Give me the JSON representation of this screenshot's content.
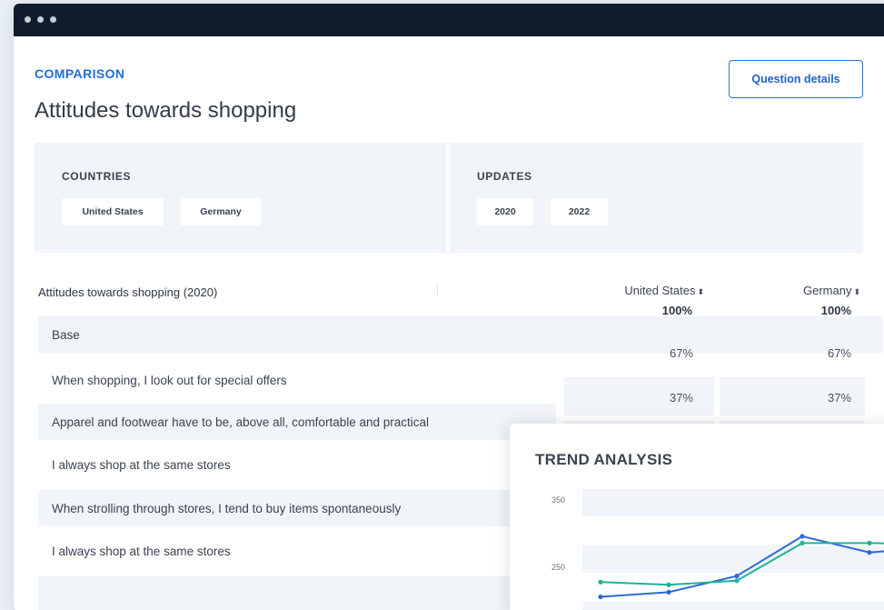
{
  "window": {
    "controls": [
      "close",
      "minimize",
      "maximize"
    ]
  },
  "header": {
    "section_label": "COMPARISON",
    "title": "Attitudes towards shopping",
    "question_button": "Question details"
  },
  "filters": {
    "countries": {
      "title": "COUNTRIES",
      "chips": [
        "United States",
        "Germany"
      ]
    },
    "updates": {
      "title": "UPDATES",
      "chips": [
        "2020",
        "2022"
      ]
    }
  },
  "table": {
    "title": "Attitudes towards shopping (2020)",
    "columns": [
      {
        "label": "United States",
        "sort_icon": "sort-icon",
        "sub": "100%"
      },
      {
        "label": "Germany",
        "sort_icon": "sort-icon",
        "sub": "100%"
      }
    ],
    "rows": [
      {
        "label": "Base",
        "values": [
          "",
          ""
        ]
      },
      {
        "label": "When shopping, I look out for special offers",
        "values": [
          "67%",
          "67%"
        ]
      },
      {
        "label": "Apparel and footwear have to be, above all, comfortable and practical",
        "values": [
          "37%",
          "37%"
        ]
      },
      {
        "label": "I always shop at the same stores",
        "values": [
          "",
          ""
        ]
      },
      {
        "label": "When strolling through stores, I tend to buy items spontaneously",
        "values": [
          "",
          ""
        ]
      },
      {
        "label": "I always shop at the same stores",
        "values": [
          "",
          ""
        ]
      }
    ]
  },
  "trend": {
    "title": "TREND ANALYSIS",
    "chart_data": {
      "type": "line",
      "y_ticks": [
        350,
        250
      ],
      "ylim": [
        200,
        350
      ],
      "grid": true,
      "series": [
        {
          "color": "#2f68d8",
          "values": [
            206,
            213,
            237,
            296,
            272,
            277
          ]
        },
        {
          "color": "#1db39a",
          "values": [
            228,
            224,
            230,
            286,
            286,
            285
          ]
        }
      ],
      "x": [
        0,
        1,
        2,
        3,
        4,
        5
      ]
    }
  },
  "colors": {
    "accent": "#1f6fd6",
    "titlebar": "#101c2e",
    "panel": "#f1f4f8"
  }
}
